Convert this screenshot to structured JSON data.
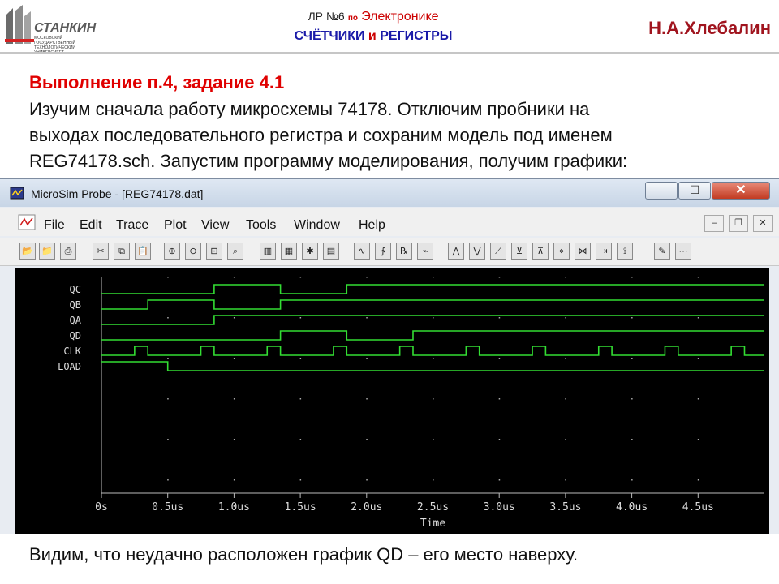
{
  "slide": {
    "logo_text": "СТАНКИН",
    "logo_subtext": "МОСКОВСКИЙ ГОСУДАРСТВЕННЫЙ ТЕХНОЛОГИЧЕСКИЙ УНИВЕРСИТЕТ",
    "header_lab_prefix": "ЛР №6",
    "header_lab_po": "по",
    "header_lab_subject": "Электронике",
    "header_topic_1": "СЧЁТЧИКИ",
    "header_topic_2": "и",
    "header_topic_3": "РЕГИСТРЫ",
    "author": "Н.А.Хлебалин",
    "heading": "Выполнение п.4, задание 4.1",
    "paragraph_lines": [
      "Изучим сначала работу микросхемы 74178. Отключим пробники на",
      "выходах последовательного регистра и сохраним модель под именем",
      "REG74178.sch. Запустим программу моделирования, получим графики:"
    ],
    "conclusion": "Видим, что неудачно расположен график QD – его место наверху."
  },
  "window": {
    "title": "MicroSim Probe - [REG74178.dat]",
    "controls": {
      "minimize": "‒",
      "maximize": "☐",
      "close": "✕"
    },
    "menu": [
      "File",
      "Edit",
      "Trace",
      "Plot",
      "View",
      "Tools",
      "Window",
      "Help"
    ],
    "mdi_controls": {
      "minimize": "‒",
      "restore": "❐",
      "close": "✕"
    },
    "toolbar": [
      {
        "name": "open-icon",
        "glyph": "📂"
      },
      {
        "name": "append-icon",
        "glyph": "📁"
      },
      {
        "name": "print-icon",
        "glyph": "⎙"
      },
      {
        "name": "cut-icon",
        "glyph": "✂"
      },
      {
        "name": "copy-icon",
        "glyph": "⧉"
      },
      {
        "name": "paste-icon",
        "glyph": "📋"
      },
      {
        "name": "zoom-in-icon",
        "glyph": "⊕"
      },
      {
        "name": "zoom-out-icon",
        "glyph": "⊖"
      },
      {
        "name": "zoom-area-icon",
        "glyph": "⊡"
      },
      {
        "name": "zoom-fit-icon",
        "glyph": "⌕"
      },
      {
        "name": "log-x-icon",
        "glyph": "▥"
      },
      {
        "name": "fourier-icon",
        "glyph": "▦"
      },
      {
        "name": "performance-icon",
        "glyph": "✱"
      },
      {
        "name": "log-y-icon",
        "glyph": "▤"
      },
      {
        "name": "add-trace-icon",
        "glyph": "∿"
      },
      {
        "name": "eval-goal-icon",
        "glyph": "∱"
      },
      {
        "name": "add-plot-icon",
        "glyph": "℞"
      },
      {
        "name": "toggle-cursor-icon",
        "glyph": "⌁"
      },
      {
        "name": "cursor-peak-icon",
        "glyph": "⋀"
      },
      {
        "name": "cursor-trough-icon",
        "glyph": "⋁"
      },
      {
        "name": "cursor-slope-icon",
        "glyph": "⟋"
      },
      {
        "name": "cursor-min-icon",
        "glyph": "⊻"
      },
      {
        "name": "cursor-max-icon",
        "glyph": "⊼"
      },
      {
        "name": "cursor-point-icon",
        "glyph": "⋄"
      },
      {
        "name": "cursor-search-icon",
        "glyph": "⋈"
      },
      {
        "name": "cursor-next-icon",
        "glyph": "⇥"
      },
      {
        "name": "mark-label-icon",
        "glyph": "⟟"
      },
      {
        "name": "label-icon",
        "glyph": "✎"
      },
      {
        "name": "mark-data-icon",
        "glyph": "⋯"
      }
    ]
  },
  "chart_data": {
    "type": "line",
    "xlabel": "Time",
    "xlim": [
      0,
      5
    ],
    "x_ticks": [
      0,
      0.5,
      1.0,
      1.5,
      2.0,
      2.5,
      3.0,
      3.5,
      4.0,
      4.5
    ],
    "x_tick_labels": [
      "0s",
      "0.5us",
      "1.0us",
      "1.5us",
      "2.0us",
      "2.5us",
      "3.0us",
      "3.5us",
      "4.0us",
      "4.5us"
    ],
    "grid": true,
    "background": "#000000",
    "trace_color": "#33dd33",
    "label_color": "#dddddd",
    "series": [
      {
        "name": "QC",
        "initial": 0,
        "transitions": [
          0.85,
          1.35,
          1.85
        ]
      },
      {
        "name": "QB",
        "initial": 0,
        "transitions": [
          0.35,
          0.85,
          1.35
        ]
      },
      {
        "name": "QA",
        "initial": 0,
        "transitions": [
          0.85
        ]
      },
      {
        "name": "QD",
        "initial": 0,
        "transitions": [
          1.35,
          1.85,
          2.35
        ]
      },
      {
        "name": "CLK",
        "initial": 0,
        "transitions": [
          0.25,
          0.35,
          0.75,
          0.85,
          1.25,
          1.35,
          1.75,
          1.85,
          2.25,
          2.35,
          2.75,
          2.85,
          3.25,
          3.35,
          3.75,
          3.85,
          4.25,
          4.35,
          4.75,
          4.85
        ]
      },
      {
        "name": "LOAD",
        "initial": 1,
        "transitions": [
          0.5
        ]
      }
    ]
  }
}
